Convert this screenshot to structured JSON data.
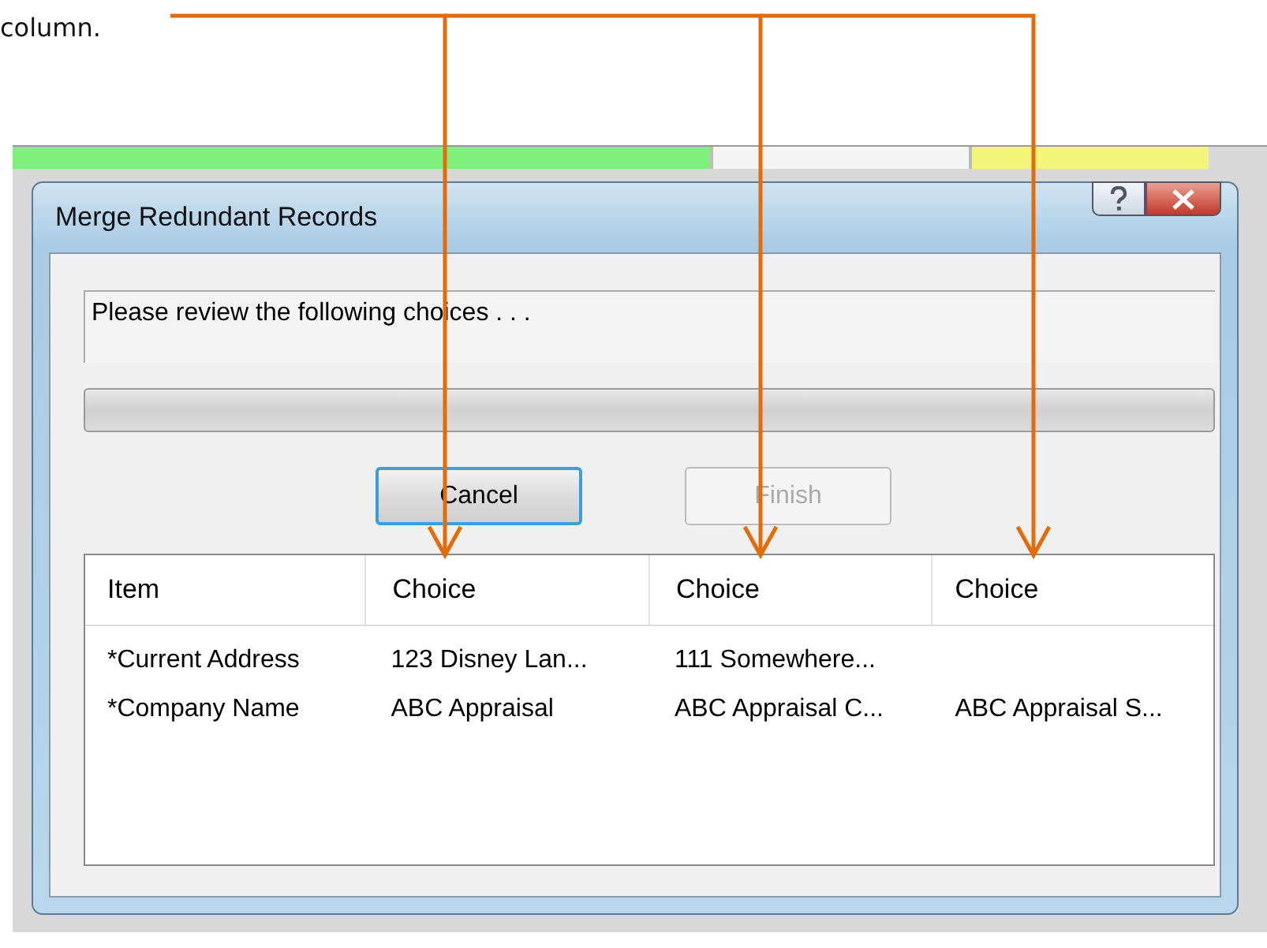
{
  "caption": "column.",
  "dialog": {
    "title": "Merge Redundant Records",
    "message": "Please review the following choices . . .",
    "progress": {
      "level": 0
    },
    "buttons": [
      {
        "label": "Cancel",
        "disabled": false,
        "focused": true
      },
      {
        "label": "Finish",
        "disabled": true,
        "focused": false
      }
    ],
    "table": {
      "columns": [
        "Item",
        "Choice",
        "Choice",
        "Choice"
      ],
      "rows": [
        {
          "item": "*Current Address",
          "choices": [
            "123 Disney Lan...",
            "111 Somewhere..."
          ]
        },
        {
          "item": "*Company Name",
          "choices": [
            "ABC Appraisal",
            "ABC Appraisal C...",
            "ABC Appraisal S..."
          ]
        }
      ]
    }
  }
}
